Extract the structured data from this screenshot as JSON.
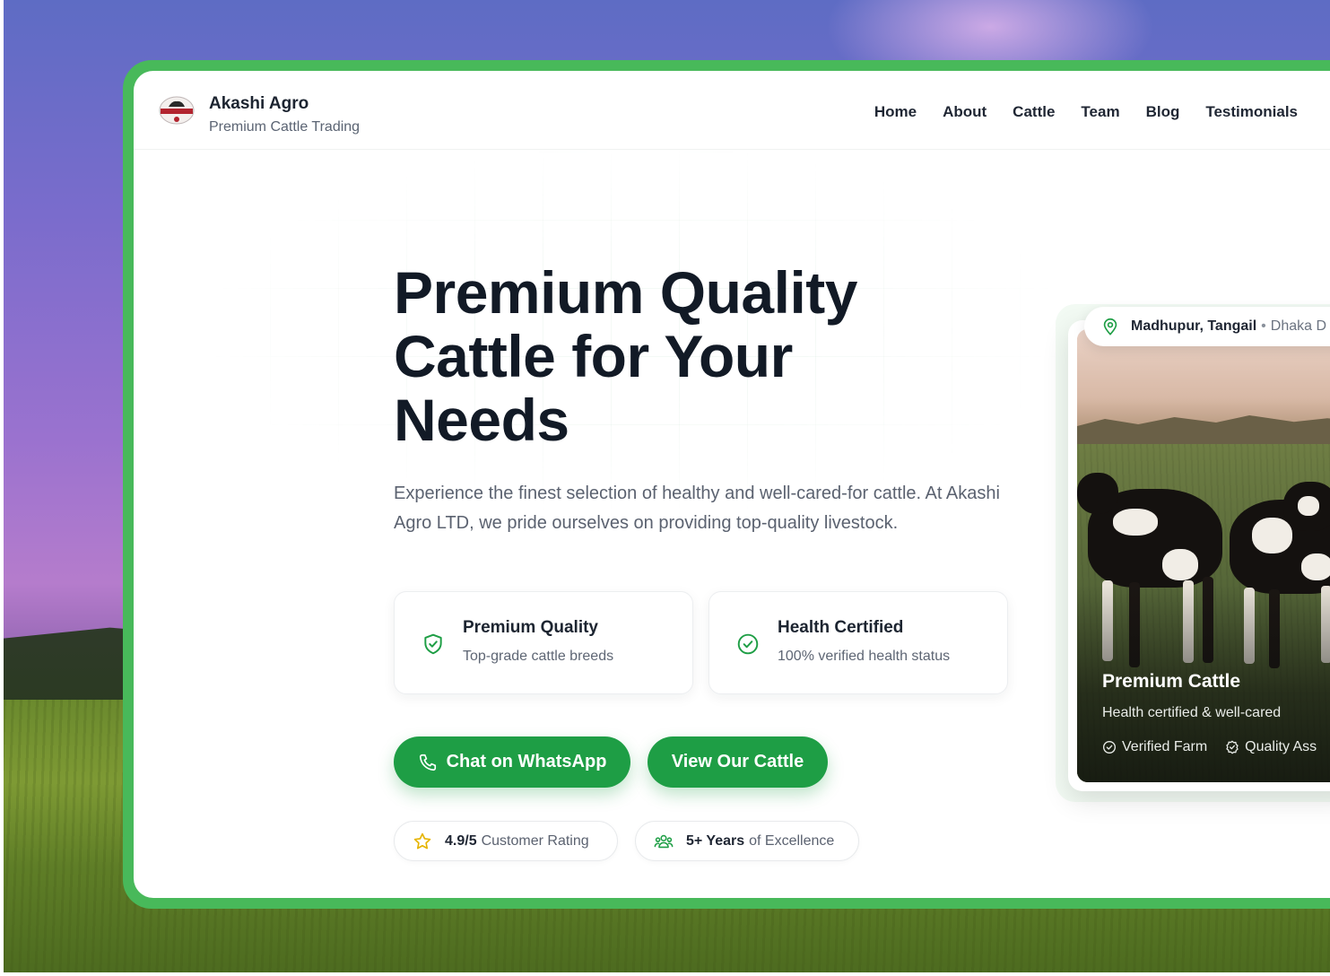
{
  "brand": {
    "name": "Akashi Agro",
    "tagline": "Premium Cattle Trading"
  },
  "nav": {
    "items": [
      {
        "label": "Home"
      },
      {
        "label": "About"
      },
      {
        "label": "Cattle"
      },
      {
        "label": "Team"
      },
      {
        "label": "Blog"
      },
      {
        "label": "Testimonials"
      }
    ]
  },
  "hero": {
    "title_line1": "Premium Quality",
    "title_line2": "Cattle for Your",
    "title_line3": "Needs",
    "description": "Experience the finest selection of healthy and well-cared-for cattle. At Akashi Agro LTD, we pride ourselves on providing top-quality livestock."
  },
  "features": [
    {
      "icon": "shield-check-icon",
      "title": "Premium Quality",
      "subtitle": "Top-grade cattle breeds"
    },
    {
      "icon": "check-circle-icon",
      "title": "Health Certified",
      "subtitle": "100% verified health status"
    }
  ],
  "buttons": {
    "whatsapp": "Chat on WhatsApp",
    "view_cattle": "View Our Cattle"
  },
  "stats": {
    "rating_value": "4.9/5",
    "rating_label": "Customer Rating",
    "years_value": "5+ Years",
    "years_label": "of Excellence"
  },
  "card": {
    "location_main": "Madhupur, Tangail",
    "location_sub": "Dhaka D",
    "title": "Premium Cattle",
    "subtitle": "Health certified & well-cared",
    "badge1": "Verified Farm",
    "badge2": "Quality Ass"
  },
  "colors": {
    "accent": "#1e9e45",
    "frame": "#48b95a",
    "heading": "#121a26",
    "star": "#e6b400"
  }
}
